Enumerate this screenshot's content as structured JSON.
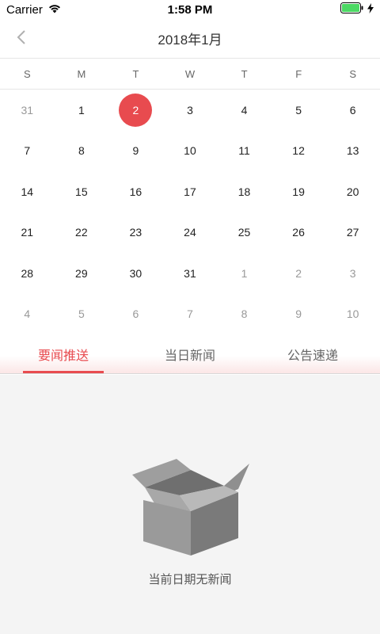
{
  "status_bar": {
    "carrier": "Carrier",
    "time": "1:58 PM"
  },
  "header": {
    "title": "2018年1月"
  },
  "calendar": {
    "weekdays": [
      "S",
      "M",
      "T",
      "W",
      "T",
      "F",
      "S"
    ],
    "days": [
      {
        "label": "31",
        "other": true
      },
      {
        "label": "1",
        "other": false
      },
      {
        "label": "2",
        "other": false,
        "selected": true
      },
      {
        "label": "3",
        "other": false
      },
      {
        "label": "4",
        "other": false
      },
      {
        "label": "5",
        "other": false
      },
      {
        "label": "6",
        "other": false
      },
      {
        "label": "7",
        "other": false
      },
      {
        "label": "8",
        "other": false
      },
      {
        "label": "9",
        "other": false
      },
      {
        "label": "10",
        "other": false
      },
      {
        "label": "11",
        "other": false
      },
      {
        "label": "12",
        "other": false
      },
      {
        "label": "13",
        "other": false
      },
      {
        "label": "14",
        "other": false
      },
      {
        "label": "15",
        "other": false
      },
      {
        "label": "16",
        "other": false
      },
      {
        "label": "17",
        "other": false
      },
      {
        "label": "18",
        "other": false
      },
      {
        "label": "19",
        "other": false
      },
      {
        "label": "20",
        "other": false
      },
      {
        "label": "21",
        "other": false
      },
      {
        "label": "22",
        "other": false
      },
      {
        "label": "23",
        "other": false
      },
      {
        "label": "24",
        "other": false
      },
      {
        "label": "25",
        "other": false
      },
      {
        "label": "26",
        "other": false
      },
      {
        "label": "27",
        "other": false
      },
      {
        "label": "28",
        "other": false
      },
      {
        "label": "29",
        "other": false
      },
      {
        "label": "30",
        "other": false
      },
      {
        "label": "31",
        "other": false
      },
      {
        "label": "1",
        "other": true
      },
      {
        "label": "2",
        "other": true
      },
      {
        "label": "3",
        "other": true
      },
      {
        "label": "4",
        "other": true
      },
      {
        "label": "5",
        "other": true
      },
      {
        "label": "6",
        "other": true
      },
      {
        "label": "7",
        "other": true
      },
      {
        "label": "8",
        "other": true
      },
      {
        "label": "9",
        "other": true
      },
      {
        "label": "10",
        "other": true
      }
    ]
  },
  "tabs": [
    "要闻推送",
    "当日新闻",
    "公告速递"
  ],
  "empty_state": {
    "message": "当前日期无新闻",
    "icon": "empty-box-icon"
  },
  "colors": {
    "accent": "#e84b4f",
    "content_bg": "#f4f4f4",
    "battery": "#4cd964"
  }
}
